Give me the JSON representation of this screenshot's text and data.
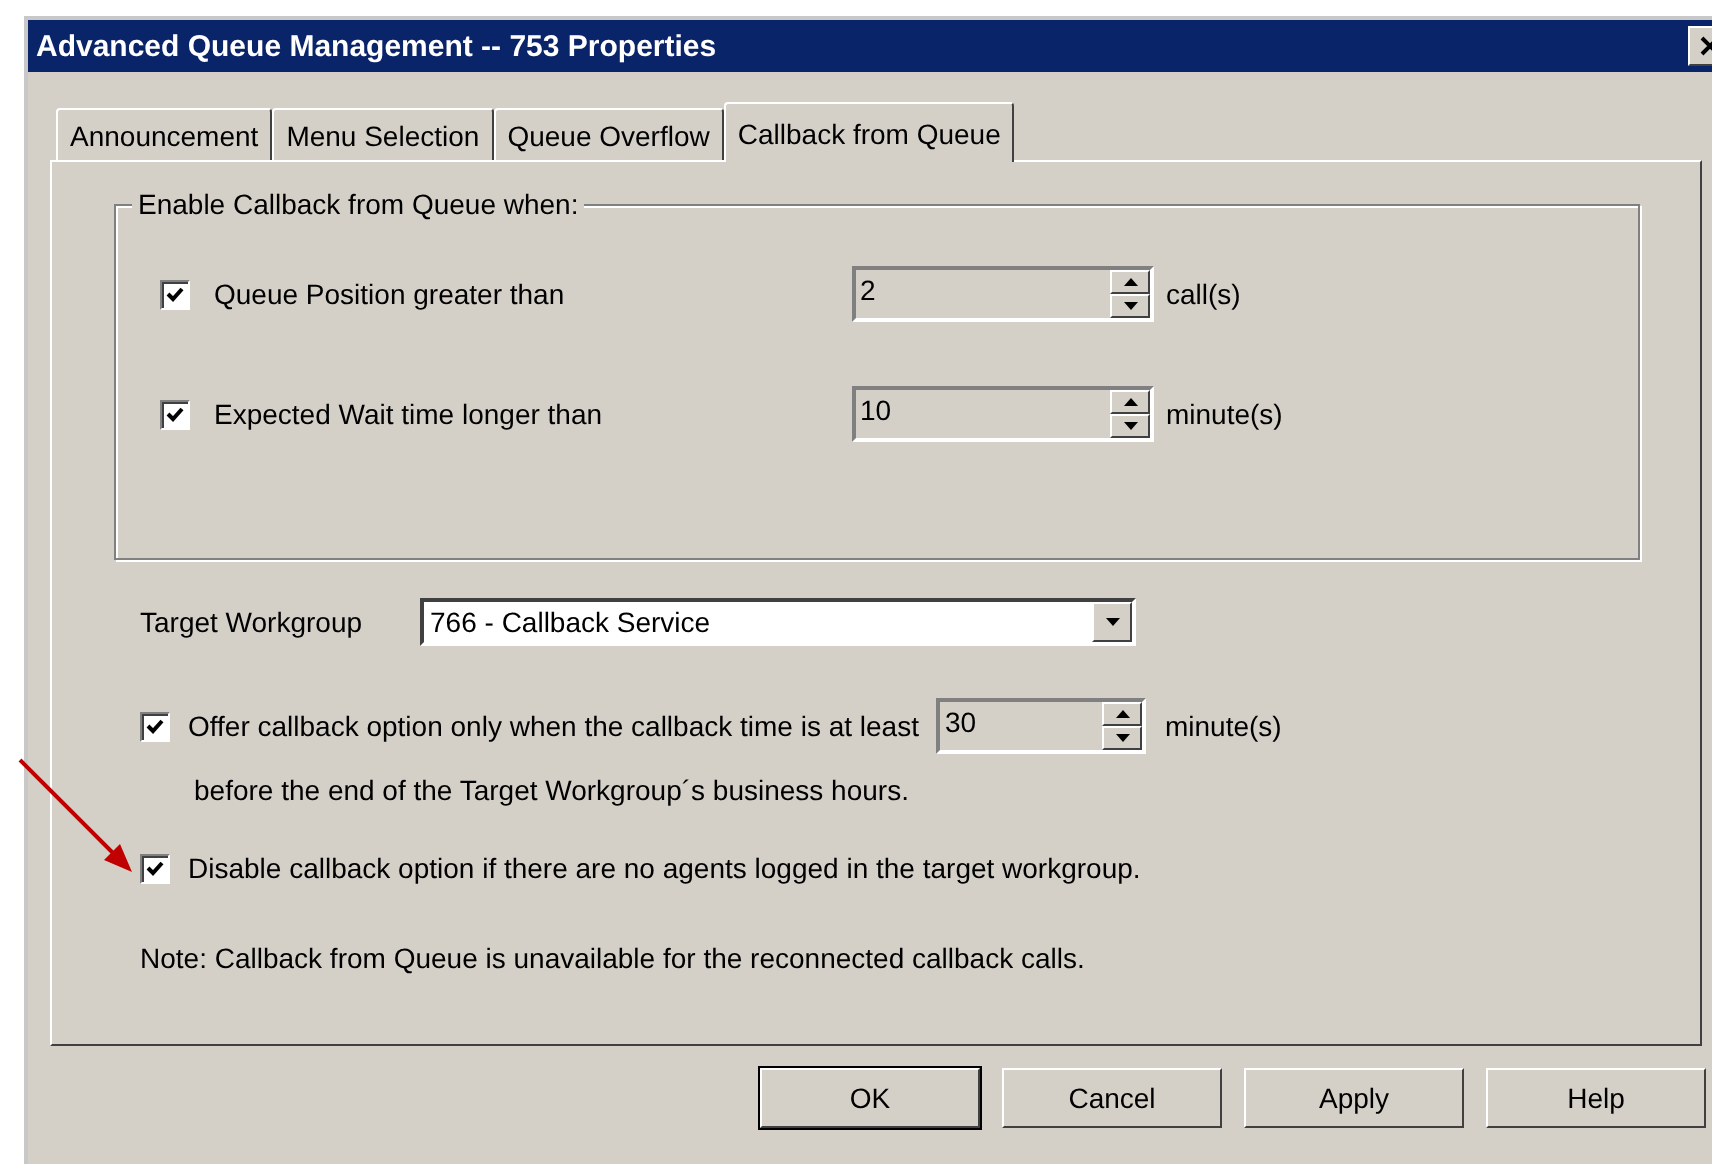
{
  "window": {
    "title": "Advanced Queue Management -- 753 Properties"
  },
  "tabs": [
    {
      "label": "Announcement",
      "selected": false
    },
    {
      "label": "Menu Selection",
      "selected": false
    },
    {
      "label": "Queue Overflow",
      "selected": false
    },
    {
      "label": "Callback from Queue",
      "selected": true
    }
  ],
  "group": {
    "title": "Enable Callback from Queue when:",
    "conditions": [
      {
        "label": "Queue Position greater than",
        "checked": true,
        "value": "2",
        "unit": "call(s)"
      },
      {
        "label": "Expected Wait time longer than",
        "checked": true,
        "value": "10",
        "unit": "minute(s)"
      }
    ]
  },
  "target_workgroup": {
    "label": "Target Workgroup",
    "value": "766 - Callback Service"
  },
  "offer_option": {
    "checked": true,
    "label": "Offer callback option only when the callback time is at least",
    "value": "30",
    "unit": "minute(s)",
    "second_line": "before the end of the Target Workgroup´s business hours."
  },
  "disable_option": {
    "checked": true,
    "label": "Disable callback option if there are no agents logged in the target workgroup."
  },
  "note": "Note: Callback from Queue is unavailable for the reconnected callback calls.",
  "buttons": [
    {
      "label": "OK",
      "default": true
    },
    {
      "label": "Cancel",
      "default": false
    },
    {
      "label": "Apply",
      "default": false
    },
    {
      "label": "Help",
      "default": false
    }
  ]
}
